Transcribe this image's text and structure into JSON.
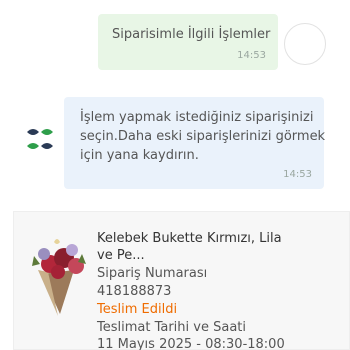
{
  "user_message": {
    "text": "Siparisimle İlgili İşlemler",
    "time": "14:53"
  },
  "bot_message": {
    "lines": [
      "İşlem yapmak istediğiniz siparişinizi",
      "seçin.Daha eski siparişlerinizi görmek",
      "için yana kaydırın."
    ],
    "time": "14:53"
  },
  "order_card": {
    "product_name_line1": "Kelebek Bukette Kırmızı, Lila",
    "product_name_line2": "ve Pe...",
    "order_number_label": "Sipariş Numarası",
    "order_number": "418188873",
    "status": "Teslim Edildi",
    "delivery_label": "Teslimat Tarihi ve Saati",
    "delivery_value": "11 Mayıs 2025 - 08:30-18:00"
  },
  "colors": {
    "user_bubble": "#e8f6e6",
    "bot_bubble": "#eaf2fb",
    "status_orange": "#ef6c00",
    "brand_green": "#2e9e4a",
    "brand_dark": "#2a3a55"
  },
  "icons": {
    "user_avatar": "user-avatar-icon",
    "bot_avatar": "brand-logo-icon",
    "product": "bouquet-image"
  }
}
